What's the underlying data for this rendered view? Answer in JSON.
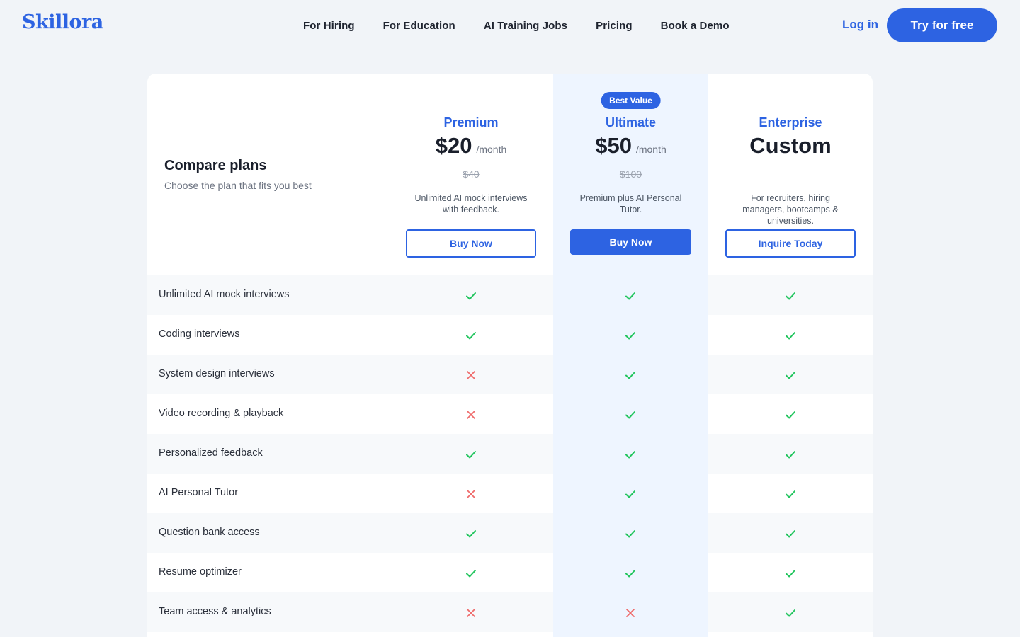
{
  "header": {
    "logo": "Skillora",
    "nav": [
      {
        "label": "For Hiring"
      },
      {
        "label": "For Education"
      },
      {
        "label": "AI Training Jobs"
      },
      {
        "label": "Pricing"
      },
      {
        "label": "Book a Demo"
      }
    ],
    "login_label": "Log in",
    "try_label": "Try for free"
  },
  "compare": {
    "title": "Compare plans",
    "subtitle": "Choose the plan that fits you best"
  },
  "plans": [
    {
      "name": "Premium",
      "price": "$20",
      "per": "/month",
      "old_price": "$40",
      "description": "Unlimited AI mock interviews with feedback.",
      "button": "Buy Now"
    },
    {
      "name": "Ultimate",
      "badge": "Best Value",
      "price": "$50",
      "per": "/month",
      "old_price": "$100",
      "description": "Premium plus AI Personal Tutor.",
      "button": "Buy Now"
    },
    {
      "name": "Enterprise",
      "price": "Custom",
      "description": "For recruiters, hiring managers, bootcamps & universities.",
      "button": "Inquire Today"
    }
  ],
  "features": [
    {
      "label": "Unlimited AI mock interviews",
      "premium": true,
      "ultimate": true,
      "enterprise": true
    },
    {
      "label": "Coding interviews",
      "premium": true,
      "ultimate": true,
      "enterprise": true
    },
    {
      "label": "System design interviews",
      "premium": false,
      "ultimate": true,
      "enterprise": true
    },
    {
      "label": "Video recording & playback",
      "premium": false,
      "ultimate": true,
      "enterprise": true
    },
    {
      "label": "Personalized feedback",
      "premium": true,
      "ultimate": true,
      "enterprise": true
    },
    {
      "label": "AI Personal Tutor",
      "premium": false,
      "ultimate": true,
      "enterprise": true
    },
    {
      "label": "Question bank access",
      "premium": true,
      "ultimate": true,
      "enterprise": true
    },
    {
      "label": "Resume optimizer",
      "premium": true,
      "ultimate": true,
      "enterprise": true
    },
    {
      "label": "Team access & analytics",
      "premium": false,
      "ultimate": false,
      "enterprise": true
    }
  ],
  "colors": {
    "accent": "#2d63e2",
    "check": "#22c55e",
    "cross": "#ef6b6b"
  },
  "icons": {
    "included": "check-icon",
    "excluded": "x-icon"
  }
}
